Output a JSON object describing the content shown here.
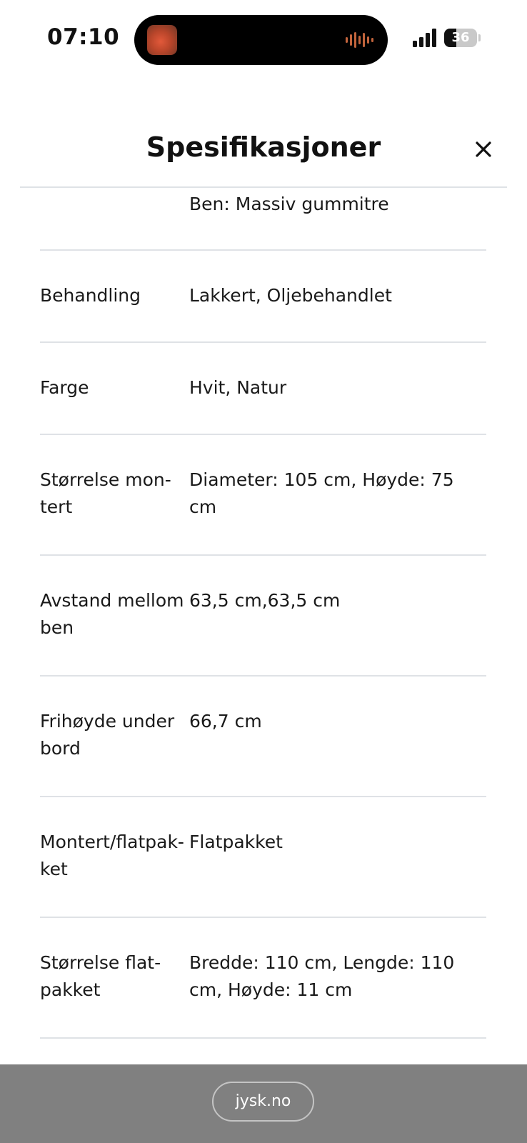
{
  "status_bar": {
    "time": "07:10",
    "battery_level": "36",
    "battery_fraction": 0.36
  },
  "header": {
    "title": "Spesifikasjoner",
    "close_icon": "close-icon"
  },
  "specs": [
    {
      "label": "",
      "value": "Ben: Massiv gummitre"
    },
    {
      "label": "Behandling",
      "value": "Lakkert, Oljebehandlet"
    },
    {
      "label": "Farge",
      "value": "Hvit, Natur"
    },
    {
      "label": "Størrelse mon-tert",
      "value": "Diameter: 105 cm, Høyde: 75 cm"
    },
    {
      "label": "Avstand mellom ben",
      "value": "63,5 cm,63,5 cm"
    },
    {
      "label": "Frihøyde under bord",
      "value": "66,7 cm"
    },
    {
      "label": "Montert/flatpak-ket",
      "value": "Flatpakket"
    },
    {
      "label": "Størrelse flat-pakket",
      "value": "Bredde: 110 cm, Lengde: 110 cm, Høyde: 11 cm"
    }
  ],
  "browser": {
    "url": "jysk.no"
  },
  "colors": {
    "divider": "#dfe2e6",
    "browser_bar": "#808080"
  }
}
